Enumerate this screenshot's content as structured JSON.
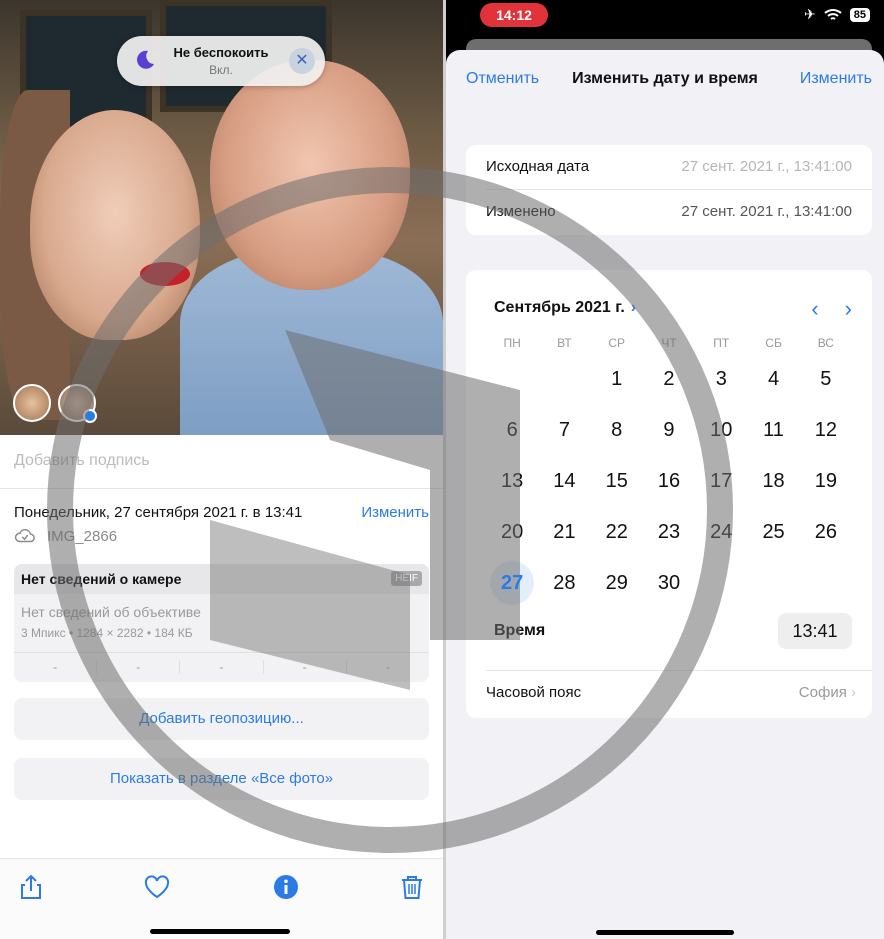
{
  "left": {
    "dnd": {
      "title": "Не беспокоить",
      "status": "Вкл.",
      "close_icon": "close-icon"
    },
    "caption_placeholder": "Добавить подпись",
    "date_text": "Понедельник, 27 сентября 2021 г. в 13:41",
    "edit_label": "Изменить",
    "file_name": "IMG_2866",
    "camera": {
      "title": "Нет сведений о камере",
      "format_badge": "HEIF",
      "lens": "Нет сведений об объективе",
      "specs": "3 Мпикс  •  1284 × 2282  •  184 КБ",
      "exif": [
        "-",
        "-",
        "-",
        "-",
        "-"
      ]
    },
    "add_location": "Добавить геопозицию...",
    "show_all_photos": "Показать в разделе «Все фото»",
    "toolbar_icons": [
      "share-icon",
      "heart-icon",
      "info-icon",
      "trash-icon"
    ]
  },
  "right": {
    "status": {
      "time": "14:12",
      "battery": "85"
    },
    "nav": {
      "cancel": "Отменить",
      "title": "Изменить дату и время",
      "done": "Изменить"
    },
    "original": {
      "label": "Исходная дата",
      "value": "27 сент. 2021 г., 13:41:00"
    },
    "adjusted": {
      "label": "Изменено",
      "value": "27 сент. 2021 г., 13:41:00"
    },
    "calendar": {
      "month": "Сентябрь 2021 г.",
      "weekdays": [
        "ПН",
        "ВТ",
        "СР",
        "ЧТ",
        "ПТ",
        "СБ",
        "ВС"
      ],
      "selected": "27"
    },
    "time_label": "Время",
    "time_value": "13:41",
    "timezone_label": "Часовой пояс",
    "timezone_value": "София"
  },
  "colors": {
    "accent": "#2b7be6",
    "status_red": "#e2333a"
  }
}
